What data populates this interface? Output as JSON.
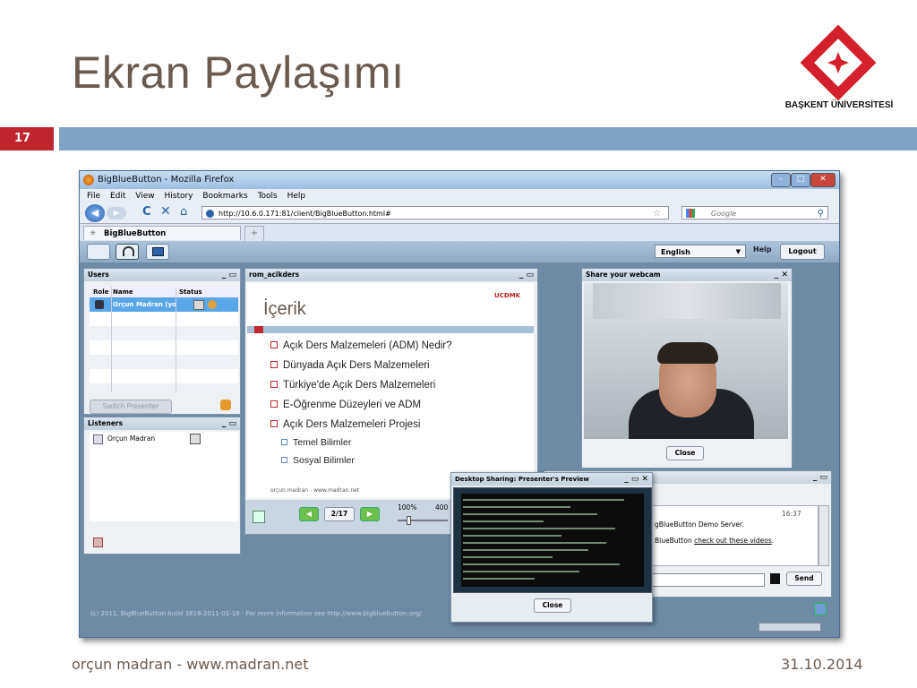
{
  "slide": {
    "title": "Ekran Paylaşımı",
    "page_number": "17",
    "university": "BAŞKENT ÜNİVERSİTESİ",
    "footer_left": "orçun madran - www.madran.net",
    "footer_right": "31.10.2014"
  },
  "browser": {
    "window_title": "BigBlueButton - Mozilla Firefox",
    "menu": [
      "File",
      "Edit",
      "View",
      "History",
      "Bookmarks",
      "Tools",
      "Help"
    ],
    "url": "http://10.6.0.171:81/client/BigBlueButton.html#",
    "search_placeholder": "Google",
    "tab_label": "BigBlueButton",
    "new_tab": "+"
  },
  "bbb": {
    "language": "English",
    "help": "Help",
    "logout": "Logout",
    "users": {
      "title": "Users",
      "columns": [
        "Role",
        "Name",
        "Status"
      ],
      "row_name": "Orçun Madran (yo",
      "switch_presenter": "Switch Presenter"
    },
    "listeners": {
      "title": "Listeners",
      "name": "Orçun Madran"
    },
    "presentation": {
      "title": "rom_acikders",
      "slide_title": "İçerik",
      "slide_logo": "UCDMK",
      "bullets": [
        "Açık Ders Malzemeleri (ADM) Nedir?",
        "Dünyada Açık Ders Malzemeleri",
        "Türkiye'de Açık Ders Malzemeleri",
        "E-Öğrenme Düzeyleri ve ADM",
        "Açık Ders Malzemeleri Projesi"
      ],
      "sub_bullets": [
        "Temel Bilimler",
        "Sosyal Bilimler"
      ],
      "slide_footer": "orçun madran - www.madran.net",
      "page_indicator": "2/17",
      "zoom_label": "100%",
      "zoom_label_2": "400"
    },
    "webcam": {
      "title": "Share your webcam",
      "close": "Close"
    },
    "desktop_sharing": {
      "title": "Desktop Sharing: Presenter's Preview",
      "close": "Close"
    },
    "chat": {
      "time": "16:37",
      "line1": "gBlueButton Demo Server.",
      "line2_prefix": "BlueButton",
      "line2_link": "check out these videos",
      "line2_suffix": ".",
      "send": "Send"
    },
    "footer": "(c) 2011, BigBlueButton build 3818-2011-01-18 - For more information see http://www.bigbluebutton.org/."
  }
}
